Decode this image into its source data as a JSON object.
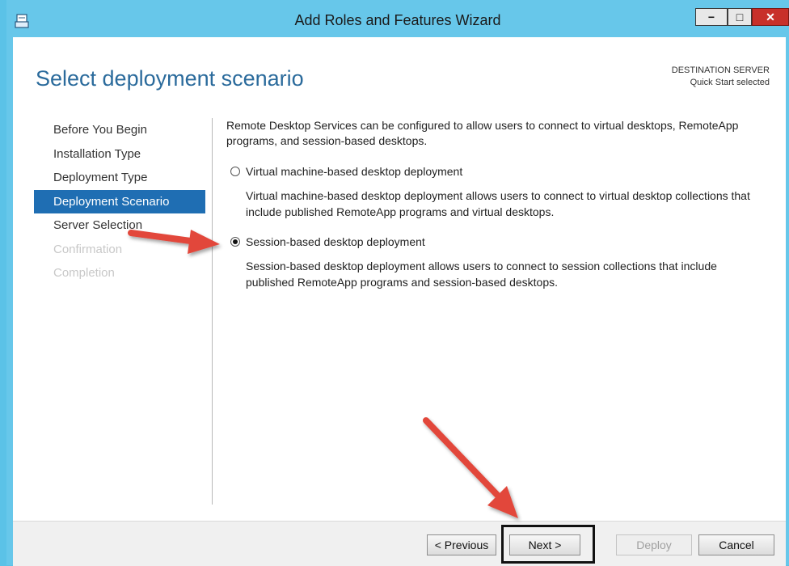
{
  "window": {
    "title": "Add Roles and Features Wizard",
    "controls": {
      "minimize": "−",
      "maximize": "□",
      "close": "✕"
    }
  },
  "header": {
    "page_title": "Select deployment scenario",
    "destination_label": "DESTINATION SERVER",
    "destination_value": "Quick Start selected"
  },
  "nav": {
    "items": [
      {
        "label": "Before You Begin",
        "state": "normal"
      },
      {
        "label": "Installation Type",
        "state": "normal"
      },
      {
        "label": "Deployment Type",
        "state": "normal"
      },
      {
        "label": "Deployment Scenario",
        "state": "active"
      },
      {
        "label": "Server Selection",
        "state": "normal"
      },
      {
        "label": "Confirmation",
        "state": "disabled"
      },
      {
        "label": "Completion",
        "state": "disabled"
      }
    ]
  },
  "content": {
    "intro": "Remote Desktop Services can be configured to allow users to connect to virtual desktops, RemoteApp programs, and session-based desktops.",
    "options": [
      {
        "label": "Virtual machine-based desktop deployment",
        "description": "Virtual machine-based desktop deployment allows users to connect to virtual desktop collections that include published RemoteApp programs and virtual desktops.",
        "selected": false
      },
      {
        "label": "Session-based desktop deployment",
        "description": "Session-based desktop deployment allows users to connect to session collections that include published RemoteApp programs and session-based desktops.",
        "selected": true
      }
    ]
  },
  "footer": {
    "previous_label": "< Previous",
    "next_label": "Next >",
    "deploy_label": "Deploy",
    "cancel_label": "Cancel",
    "deploy_enabled": false
  },
  "colors": {
    "titlebar": "#67c7ea",
    "accent": "#1f6eb3",
    "page_title": "#2b6b9c",
    "annotation_arrow": "#e2473a"
  }
}
